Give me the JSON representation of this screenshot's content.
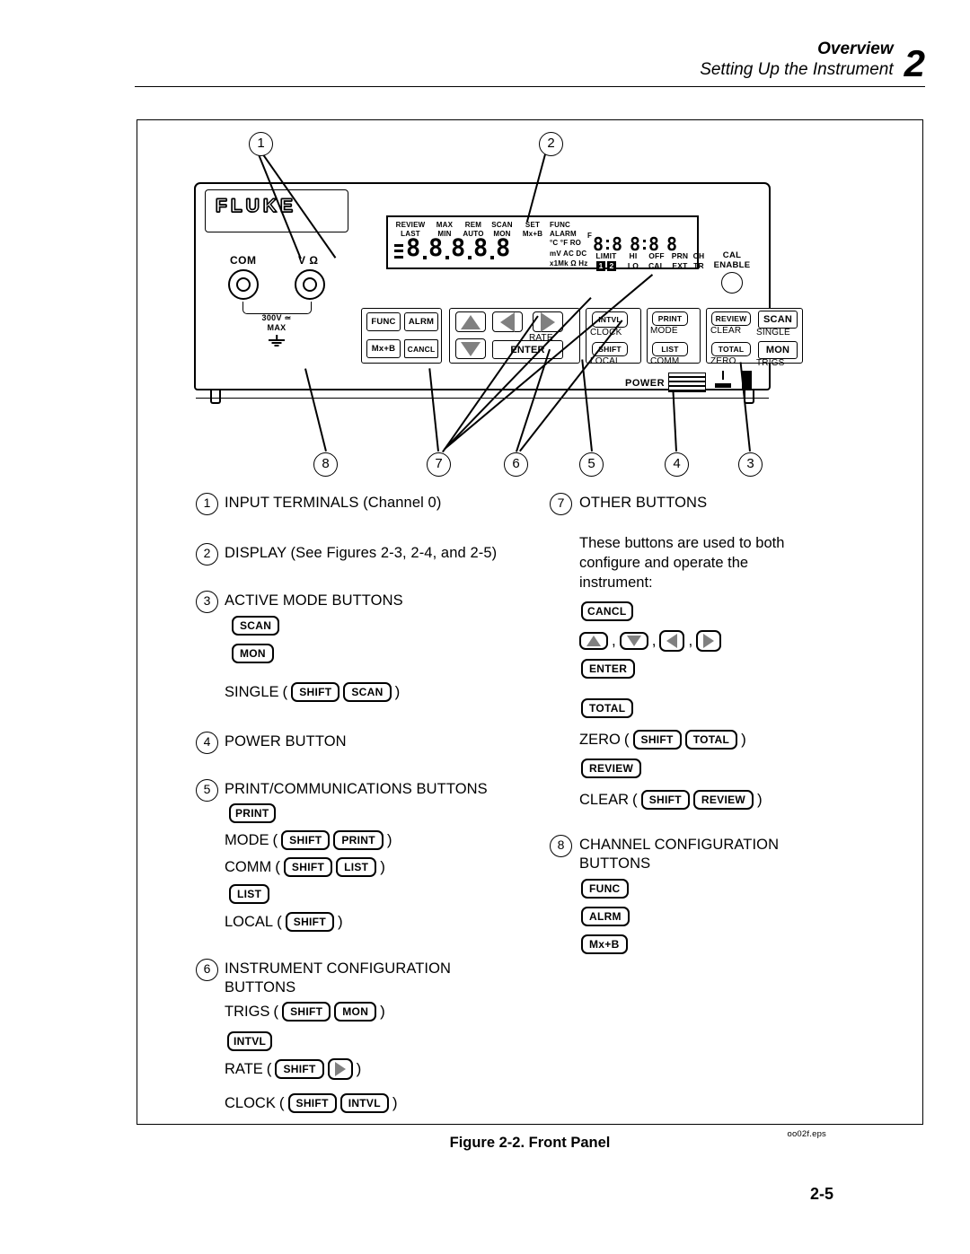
{
  "header": {
    "overview": "Overview",
    "subtitle": "Setting Up the Instrument",
    "chapter": "2"
  },
  "instrument": {
    "brand": "FLUKE",
    "terminals": {
      "com_label": "COM",
      "v_ohm_label": "V Ω",
      "rating_line1": "300V",
      "rating_line2": "MAX"
    },
    "cal": {
      "line1": "CAL",
      "line2": "ENABLE"
    },
    "power_label": "POWER",
    "display": {
      "annunciators": [
        {
          "top": "REVIEW",
          "bottom": "LAST"
        },
        {
          "top": "MAX",
          "bottom": "MIN"
        },
        {
          "top": "REM",
          "bottom": "AUTO"
        },
        {
          "top": "SCAN",
          "bottom": "MON"
        },
        {
          "top": "SET",
          "bottom": "Mx+B"
        }
      ],
      "units": [
        "FUNC",
        "ALARM",
        "°C °F RO",
        "mV AC DC",
        "x1Mk Ω Hz"
      ],
      "f_mark": "F",
      "status": [
        {
          "top": "LIMIT",
          "bottom": "1 2"
        },
        {
          "top": "HI",
          "bottom": "LO"
        },
        {
          "top": "OFF",
          "bottom": "CAL"
        },
        {
          "top": "PRN",
          "bottom": "EXT"
        },
        {
          "top": "CH",
          "bottom": "TR"
        }
      ],
      "limit_1": "1",
      "limit_2": "2"
    },
    "keys": {
      "func": "FUNC",
      "alrm": "ALRM",
      "mxb": "Mx+B",
      "cancl": "CANCL",
      "enter": "ENTER",
      "intvl": "INTVL",
      "clock": "CLOCK",
      "rate": "RATE",
      "shift": "SHIFT",
      "local": "LOCAL",
      "print": "PRINT",
      "mode": "MODE",
      "list": "LIST",
      "comm": "COMM",
      "review": "REVIEW",
      "clear": "CLEAR",
      "total": "TOTAL",
      "zero": "ZERO",
      "scan": "SCAN",
      "single": "SINGLE",
      "mon": "MON",
      "trigs": "TRIGS"
    }
  },
  "callouts": [
    "1",
    "2",
    "3",
    "4",
    "5",
    "6",
    "7",
    "8"
  ],
  "legend": {
    "item1": {
      "num": "1",
      "title": "INPUT TERMINALS (Channel 0)"
    },
    "item2": {
      "num": "2",
      "title": "DISPLAY (See Figures 2-3, 2-4, and 2-5)"
    },
    "item3": {
      "num": "3",
      "title": "ACTIVE MODE BUTTONS",
      "btn_scan": "SCAN",
      "btn_mon": "MON",
      "single_label": "SINGLE",
      "single_shift": "SHIFT",
      "single_scan": "SCAN"
    },
    "item4": {
      "num": "4",
      "title": "POWER BUTTON"
    },
    "item5": {
      "num": "5",
      "title": "PRINT/COMMUNICATIONS BUTTONS",
      "btn_print": "PRINT",
      "mode_label": "MODE",
      "mode_shift": "SHIFT",
      "mode_print": "PRINT",
      "comm_label": "COMM",
      "comm_shift": "SHIFT",
      "comm_list": "LIST",
      "btn_list": "LIST",
      "local_label": "LOCAL",
      "local_shift": "SHIFT"
    },
    "item6": {
      "num": "6",
      "title_line1": "INSTRUMENT CONFIGURATION",
      "title_line2": "BUTTONS",
      "trigs_label": "TRIGS",
      "trigs_shift": "SHIFT",
      "trigs_mon": "MON",
      "btn_intvl": "INTVL",
      "rate_label": "RATE",
      "rate_shift": "SHIFT",
      "clock_label": "CLOCK",
      "clock_shift": "SHIFT",
      "clock_intvl": "INTVL"
    },
    "item7": {
      "num": "7",
      "title": "OTHER BUTTONS",
      "paragraph": "These buttons are used to both configure  and operate the instrument:",
      "btn_cancl": "CANCL",
      "btn_enter": "ENTER",
      "btn_total": "TOTAL",
      "zero_label": "ZERO",
      "zero_shift": "SHIFT",
      "zero_total": "TOTAL",
      "btn_review": "REVIEW",
      "clear_label": "CLEAR",
      "clear_shift": "SHIFT",
      "clear_review": "REVIEW"
    },
    "item8": {
      "num": "8",
      "title_line1": "CHANNEL CONFIGURATION",
      "title_line2": "BUTTONS",
      "btn_func": "FUNC",
      "btn_alrm": "ALRM",
      "btn_mxb": "Mx+B"
    }
  },
  "footer": {
    "eps": "oo02f.eps",
    "caption": "Figure 2-2. Front Panel",
    "page": "2-5"
  }
}
